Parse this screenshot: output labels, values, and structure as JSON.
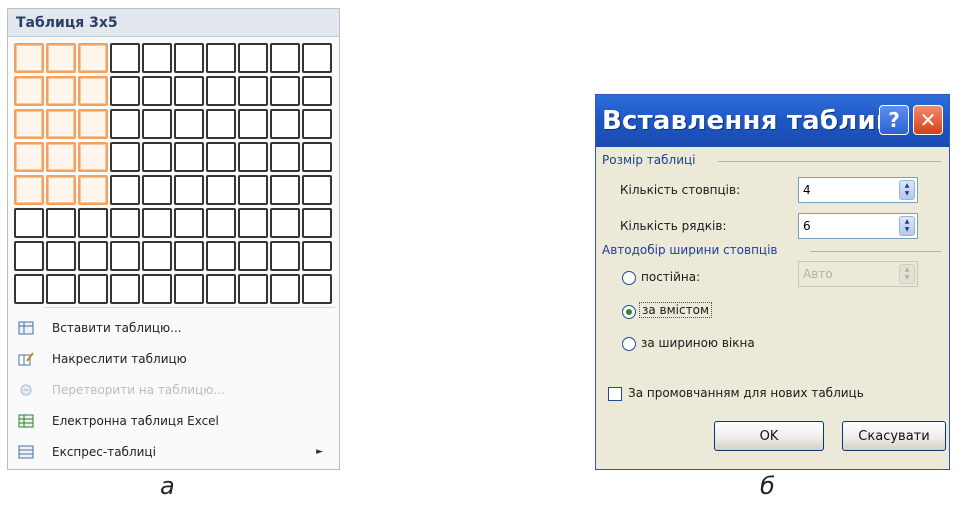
{
  "panel_a": {
    "header": "Таблиця 3x5",
    "grid": {
      "columns": 10,
      "rows": 8,
      "selected_columns": 3,
      "selected_rows": 5
    },
    "menu": [
      {
        "label": "Вставити таблицю...",
        "icon": "table-icon",
        "enabled": true,
        "submenu": false
      },
      {
        "label": "Накреслити таблицю",
        "icon": "draw-table-icon",
        "enabled": true,
        "submenu": false
      },
      {
        "label": "Перетворити на таблицю...",
        "icon": "convert-table-icon",
        "enabled": false,
        "submenu": false
      },
      {
        "label": "Електронна таблиця Excel",
        "icon": "excel-icon",
        "enabled": true,
        "submenu": false
      },
      {
        "label": "Експрес-таблиці",
        "icon": "quick-tables-icon",
        "enabled": true,
        "submenu": true,
        "arrow": "►"
      }
    ],
    "caption": "а"
  },
  "panel_b": {
    "title": "Вставлення таблиці",
    "help_glyph": "?",
    "close_glyph": "✕",
    "size_group": "Розмір таблиці",
    "columns_label": "Кількість стовпців:",
    "columns_value": "4",
    "rows_label": "Кількість рядків:",
    "rows_value": "6",
    "autofit_group": "Автодобір ширини стовпців",
    "fixed_label": "постійна:",
    "fixed_value": "Авто",
    "content_label": "за вмістом",
    "window_label": "за шириною вікна",
    "selected_option": "content",
    "remember_label": "За промовчанням для нових таблиць",
    "remember_checked": false,
    "ok_label": "OK",
    "cancel_label": "Скасувати",
    "caption": "б"
  },
  "colors": {
    "selection": "#f2a15e",
    "title_bar": "#1f58c5",
    "dialog_bg": "#ece9d8"
  }
}
